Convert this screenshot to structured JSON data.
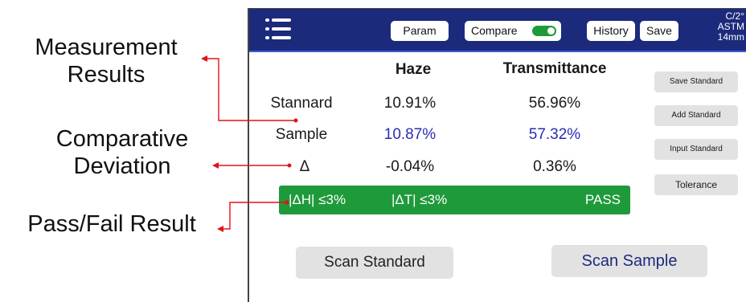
{
  "annotations": {
    "measurement_results": "Measurement\nResults",
    "comparative_deviation": "Comparative\nDeviation",
    "pass_fail_result": "Pass/Fail Result"
  },
  "topbar": {
    "param_label": "Param",
    "compare_label": "Compare",
    "compare_toggle_on": true,
    "history_label": "History",
    "save_label": "Save",
    "corner_line1": "C/2°",
    "corner_line2": "ASTM",
    "corner_line3": "14mm"
  },
  "table": {
    "headers": {
      "haze": "Haze",
      "transmittance": "Transmittance"
    },
    "rows": [
      {
        "label": "Stannard",
        "haze": "10.91%",
        "transmittance": "56.96%"
      },
      {
        "label": "Sample",
        "haze": "10.87%",
        "transmittance": "57.32%"
      },
      {
        "label": "Δ",
        "haze": "-0.04%",
        "transmittance": "0.36%"
      }
    ]
  },
  "result": {
    "haze_tolerance": "|ΔH| ≤3%",
    "transmittance_tolerance": "|ΔT| ≤3%",
    "status": "PASS"
  },
  "side_buttons": {
    "save_standard": "Save Standard",
    "add_standard": "Add Standard",
    "input_standard": "Input Standard",
    "tolerance": "Tolerance"
  },
  "bottom_buttons": {
    "scan_standard": "Scan Standard",
    "scan_sample": "Scan Sample"
  },
  "colors": {
    "topbar": "#1c2a7c",
    "pass_green": "#1f9a3a",
    "annotation_red": "#e0121a",
    "sample_blue": "#2b2bb5"
  }
}
